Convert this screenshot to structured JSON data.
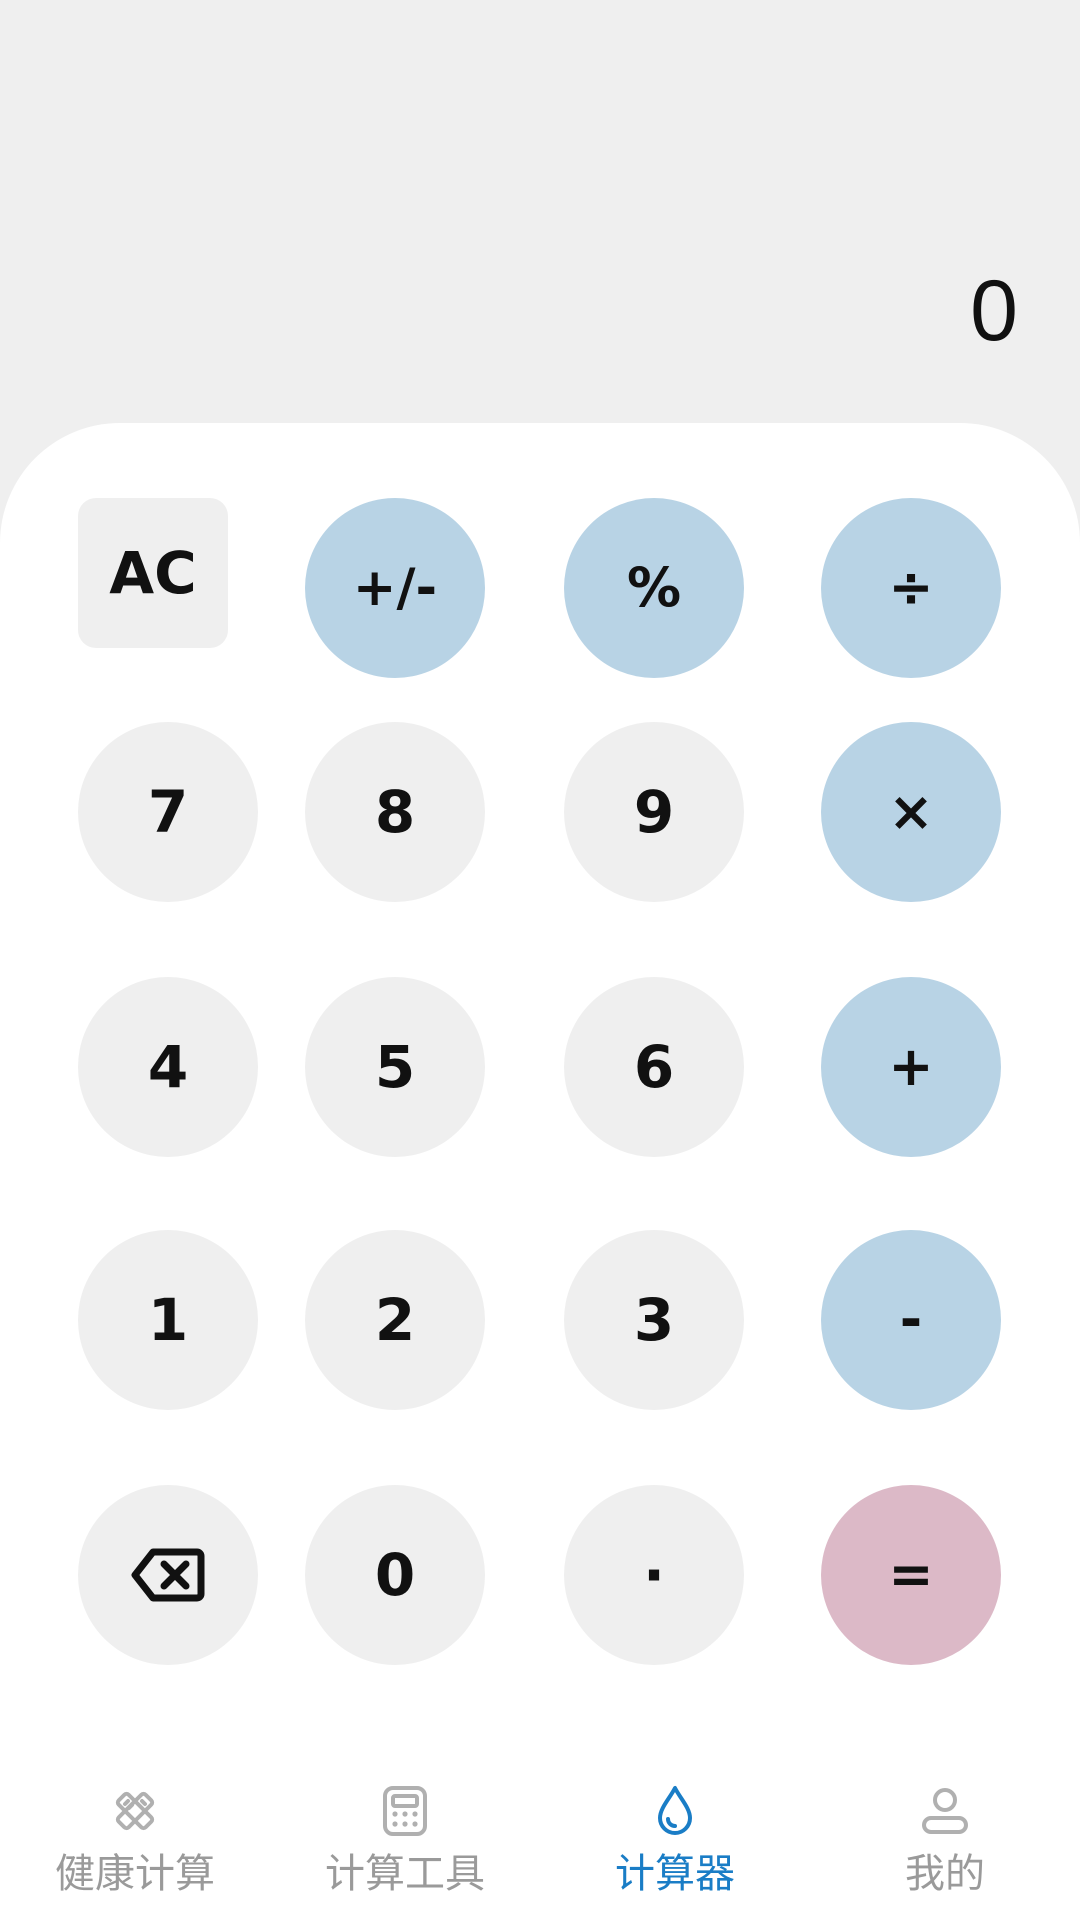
{
  "display": {
    "value": "0"
  },
  "keys": {
    "ac": "AC",
    "sign": "+/-",
    "percent": "%",
    "divide": "÷",
    "seven": "7",
    "eight": "8",
    "nine": "9",
    "multiply": "×",
    "four": "4",
    "five": "5",
    "six": "6",
    "plus": "+",
    "one": "1",
    "two": "2",
    "three": "3",
    "minus": "-",
    "zero": "0",
    "dot": "·",
    "equals": "="
  },
  "nav": {
    "items": [
      {
        "label": "健康计算",
        "icon": "health-tools-icon",
        "active": false
      },
      {
        "label": "计算工具",
        "icon": "calculator-tool-icon",
        "active": false
      },
      {
        "label": "计算器",
        "icon": "water-drop-icon",
        "active": true
      },
      {
        "label": "我的",
        "icon": "profile-icon",
        "active": false
      }
    ]
  },
  "colors": {
    "display_bg": "#efefef",
    "key_bg": "#efefef",
    "operator_bg": "#b8d3e5",
    "equals_bg": "#dcb9c7",
    "nav_active": "#1a7dc6",
    "nav_inactive": "#9a9a9a"
  }
}
